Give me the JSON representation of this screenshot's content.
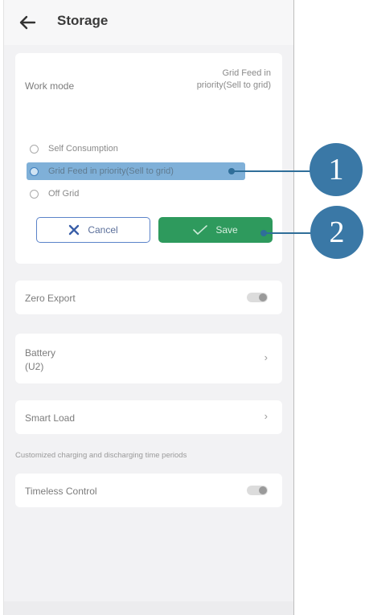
{
  "header": {
    "title": "Storage",
    "back_icon": "arrow-left-icon"
  },
  "work_mode": {
    "label": "Work mode",
    "value": "Grid Feed in priority(Sell to grid)",
    "options": [
      {
        "label": "Self Consumption",
        "selected": false
      },
      {
        "label": "Grid Feed in priority(Sell to grid)",
        "selected": true
      },
      {
        "label": "Off Grid",
        "selected": false
      }
    ],
    "cancel_label": "Cancel",
    "save_label": "Save"
  },
  "zero_export": {
    "label": "Zero Export",
    "enabled": true
  },
  "battery": {
    "label": "Battery",
    "value": "(U2)"
  },
  "smart_load": {
    "label": "Smart Load"
  },
  "caption": "Customized charging and discharging time periods",
  "timeless": {
    "label": "Timeless Control",
    "enabled": true
  },
  "callouts": [
    "1",
    "2"
  ],
  "colors": {
    "save": "#2e9a5d",
    "callout": "#3a78a6",
    "highlight": "#7fb0d8"
  }
}
